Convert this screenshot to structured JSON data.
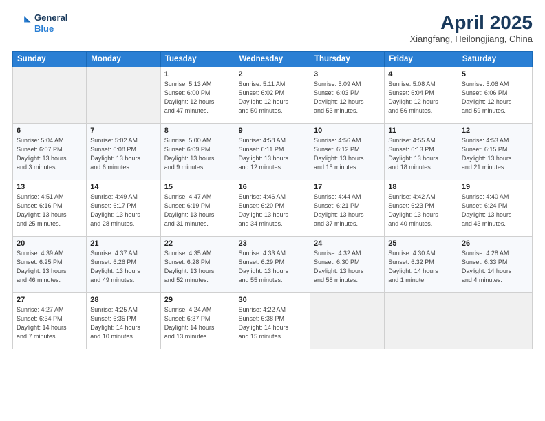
{
  "header": {
    "logo_line1": "General",
    "logo_line2": "Blue",
    "title": "April 2025",
    "subtitle": "Xiangfang, Heilongjiang, China"
  },
  "weekdays": [
    "Sunday",
    "Monday",
    "Tuesday",
    "Wednesday",
    "Thursday",
    "Friday",
    "Saturday"
  ],
  "weeks": [
    [
      {
        "num": "",
        "info": ""
      },
      {
        "num": "",
        "info": ""
      },
      {
        "num": "1",
        "info": "Sunrise: 5:13 AM\nSunset: 6:00 PM\nDaylight: 12 hours\nand 47 minutes."
      },
      {
        "num": "2",
        "info": "Sunrise: 5:11 AM\nSunset: 6:02 PM\nDaylight: 12 hours\nand 50 minutes."
      },
      {
        "num": "3",
        "info": "Sunrise: 5:09 AM\nSunset: 6:03 PM\nDaylight: 12 hours\nand 53 minutes."
      },
      {
        "num": "4",
        "info": "Sunrise: 5:08 AM\nSunset: 6:04 PM\nDaylight: 12 hours\nand 56 minutes."
      },
      {
        "num": "5",
        "info": "Sunrise: 5:06 AM\nSunset: 6:06 PM\nDaylight: 12 hours\nand 59 minutes."
      }
    ],
    [
      {
        "num": "6",
        "info": "Sunrise: 5:04 AM\nSunset: 6:07 PM\nDaylight: 13 hours\nand 3 minutes."
      },
      {
        "num": "7",
        "info": "Sunrise: 5:02 AM\nSunset: 6:08 PM\nDaylight: 13 hours\nand 6 minutes."
      },
      {
        "num": "8",
        "info": "Sunrise: 5:00 AM\nSunset: 6:09 PM\nDaylight: 13 hours\nand 9 minutes."
      },
      {
        "num": "9",
        "info": "Sunrise: 4:58 AM\nSunset: 6:11 PM\nDaylight: 13 hours\nand 12 minutes."
      },
      {
        "num": "10",
        "info": "Sunrise: 4:56 AM\nSunset: 6:12 PM\nDaylight: 13 hours\nand 15 minutes."
      },
      {
        "num": "11",
        "info": "Sunrise: 4:55 AM\nSunset: 6:13 PM\nDaylight: 13 hours\nand 18 minutes."
      },
      {
        "num": "12",
        "info": "Sunrise: 4:53 AM\nSunset: 6:15 PM\nDaylight: 13 hours\nand 21 minutes."
      }
    ],
    [
      {
        "num": "13",
        "info": "Sunrise: 4:51 AM\nSunset: 6:16 PM\nDaylight: 13 hours\nand 25 minutes."
      },
      {
        "num": "14",
        "info": "Sunrise: 4:49 AM\nSunset: 6:17 PM\nDaylight: 13 hours\nand 28 minutes."
      },
      {
        "num": "15",
        "info": "Sunrise: 4:47 AM\nSunset: 6:19 PM\nDaylight: 13 hours\nand 31 minutes."
      },
      {
        "num": "16",
        "info": "Sunrise: 4:46 AM\nSunset: 6:20 PM\nDaylight: 13 hours\nand 34 minutes."
      },
      {
        "num": "17",
        "info": "Sunrise: 4:44 AM\nSunset: 6:21 PM\nDaylight: 13 hours\nand 37 minutes."
      },
      {
        "num": "18",
        "info": "Sunrise: 4:42 AM\nSunset: 6:23 PM\nDaylight: 13 hours\nand 40 minutes."
      },
      {
        "num": "19",
        "info": "Sunrise: 4:40 AM\nSunset: 6:24 PM\nDaylight: 13 hours\nand 43 minutes."
      }
    ],
    [
      {
        "num": "20",
        "info": "Sunrise: 4:39 AM\nSunset: 6:25 PM\nDaylight: 13 hours\nand 46 minutes."
      },
      {
        "num": "21",
        "info": "Sunrise: 4:37 AM\nSunset: 6:26 PM\nDaylight: 13 hours\nand 49 minutes."
      },
      {
        "num": "22",
        "info": "Sunrise: 4:35 AM\nSunset: 6:28 PM\nDaylight: 13 hours\nand 52 minutes."
      },
      {
        "num": "23",
        "info": "Sunrise: 4:33 AM\nSunset: 6:29 PM\nDaylight: 13 hours\nand 55 minutes."
      },
      {
        "num": "24",
        "info": "Sunrise: 4:32 AM\nSunset: 6:30 PM\nDaylight: 13 hours\nand 58 minutes."
      },
      {
        "num": "25",
        "info": "Sunrise: 4:30 AM\nSunset: 6:32 PM\nDaylight: 14 hours\nand 1 minute."
      },
      {
        "num": "26",
        "info": "Sunrise: 4:28 AM\nSunset: 6:33 PM\nDaylight: 14 hours\nand 4 minutes."
      }
    ],
    [
      {
        "num": "27",
        "info": "Sunrise: 4:27 AM\nSunset: 6:34 PM\nDaylight: 14 hours\nand 7 minutes."
      },
      {
        "num": "28",
        "info": "Sunrise: 4:25 AM\nSunset: 6:35 PM\nDaylight: 14 hours\nand 10 minutes."
      },
      {
        "num": "29",
        "info": "Sunrise: 4:24 AM\nSunset: 6:37 PM\nDaylight: 14 hours\nand 13 minutes."
      },
      {
        "num": "30",
        "info": "Sunrise: 4:22 AM\nSunset: 6:38 PM\nDaylight: 14 hours\nand 15 minutes."
      },
      {
        "num": "",
        "info": ""
      },
      {
        "num": "",
        "info": ""
      },
      {
        "num": "",
        "info": ""
      }
    ]
  ]
}
